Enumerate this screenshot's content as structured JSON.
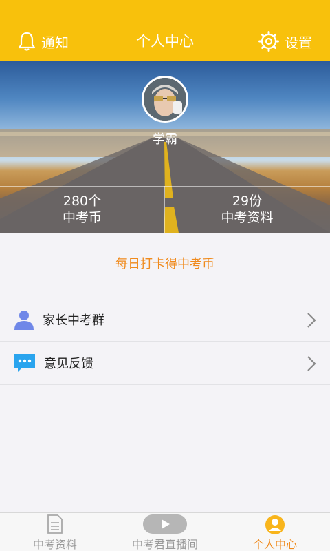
{
  "header": {
    "left_label": "通知",
    "title": "个人中心",
    "right_label": "设置"
  },
  "profile": {
    "username": "学霸",
    "stats": [
      {
        "value": "280个",
        "label": "中考币"
      },
      {
        "value": "29份",
        "label": "中考资料"
      }
    ]
  },
  "checkin": {
    "label": "每日打卡得中考币"
  },
  "menu": {
    "items": [
      {
        "label": "家长中考群",
        "icon": "user-icon"
      },
      {
        "label": "意见反馈",
        "icon": "chat-bubble-icon"
      }
    ]
  },
  "bottom_nav": {
    "tabs": [
      {
        "label": "中考资料",
        "icon": "document-icon",
        "active": false
      },
      {
        "label": "中考君直播间",
        "icon": "play-icon",
        "active": false
      },
      {
        "label": "个人中心",
        "icon": "user-circle-icon",
        "active": true
      }
    ]
  },
  "colors": {
    "header_bg": "#f8c10c",
    "accent_orange": "#f08a1c",
    "icon_blue": "#6f87e8",
    "chat_blue": "#2aa4ee"
  }
}
